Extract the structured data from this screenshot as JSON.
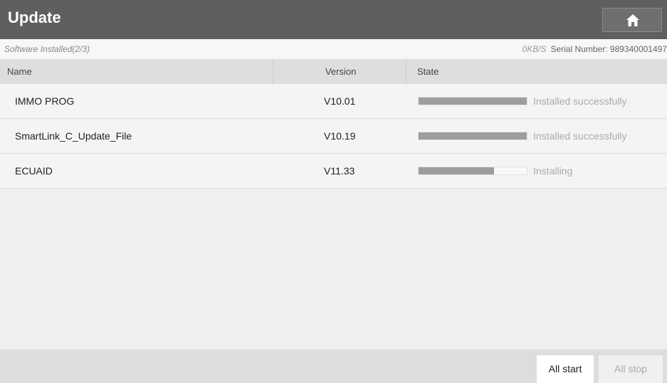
{
  "header": {
    "title": "Update",
    "home_icon": "home-icon"
  },
  "status": {
    "installed": "Software Installed(2/3)",
    "speed": "0KB/S",
    "serial": "Serial Number:  989340001497"
  },
  "table": {
    "columns": [
      "Name",
      "Version",
      "State"
    ],
    "rows": [
      {
        "name": "IMMO PROG",
        "version": "V10.01",
        "progress": 1.0,
        "state": "Installed successfully"
      },
      {
        "name": "SmartLink_C_Update_File",
        "version": "V10.19",
        "progress": 1.0,
        "state": "Installed successfully"
      },
      {
        "name": "ECUAID",
        "version": "V11.33",
        "progress": 0.7,
        "state": "Installing"
      }
    ]
  },
  "buttons": {
    "all_start": "All start",
    "all_stop": "All stop"
  },
  "colors": {
    "title_bar": "#5f5f5f",
    "progress_fill": "#9d9d9d"
  }
}
